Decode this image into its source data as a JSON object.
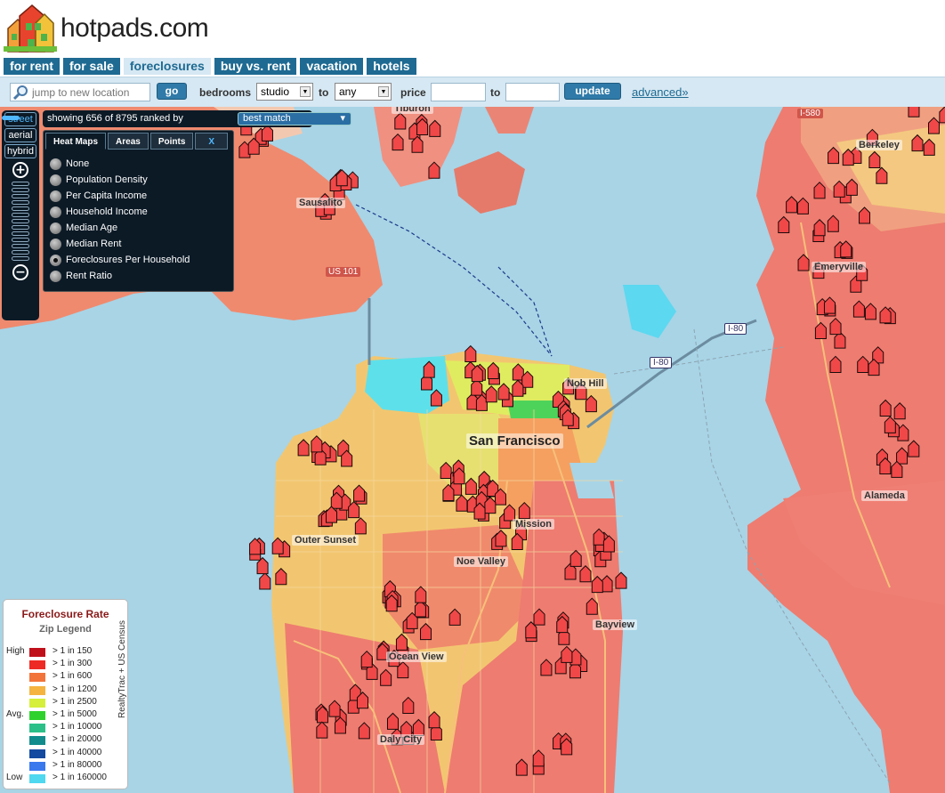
{
  "brand": {
    "name": "hotpads.com"
  },
  "tabs": [
    {
      "label": "for rent"
    },
    {
      "label": "for sale"
    },
    {
      "label": "foreclosures"
    },
    {
      "label": "buy vs. rent"
    },
    {
      "label": "vacation"
    },
    {
      "label": "hotels"
    }
  ],
  "search": {
    "placeholder": "jump to new location",
    "go_label": "go",
    "bedrooms_label": "bedrooms",
    "bedrooms_from": "studio",
    "to_label": "to",
    "bedrooms_to": "any",
    "price_label": "price",
    "price_to_label": "to",
    "update_label": "update",
    "advanced_label": "advanced»"
  },
  "view_controls": {
    "street": "street",
    "aerial": "aerial",
    "hybrid": "hybrid",
    "zoom_in": "+",
    "zoom_out": "−",
    "zoom_level": 7,
    "zoom_levels": 14
  },
  "results": {
    "showing_text": "showing 656 of 8795 ranked by",
    "rank_by": "best match"
  },
  "heat_panel": {
    "tabs": [
      "Heat Maps",
      "Areas",
      "Points",
      "X"
    ],
    "options": [
      "None",
      "Population Density",
      "Per Capita Income",
      "Household Income",
      "Median Age",
      "Median Rent",
      "Foreclosures Per Household",
      "Rent Ratio"
    ],
    "selected": "Foreclosures Per Household"
  },
  "map": {
    "place_labels": {
      "tiburon": "Tiburon",
      "berkeley": "Berkeley",
      "sausalito": "Sausalito",
      "emeryville": "Emeryville",
      "san_francisco": "San Francisco",
      "alameda": "Alameda",
      "outer_sunset": "Outer Sunset",
      "mission": "Mission",
      "noe_valley": "Noe Valley",
      "bayview": "Bayview",
      "ocean_view": "Ocean View",
      "daly_city": "Daly City",
      "nob_hill": "Nob Hill"
    },
    "shields": {
      "us101": "US 101",
      "i80": "I-80",
      "i80b": "I-80",
      "i580": "I-580"
    }
  },
  "legend": {
    "title": "Foreclosure Rate",
    "subtitle": "Zip Legend",
    "source": "RealtyTrac + US Census",
    "rows": [
      {
        "level": "High",
        "color": "#c0111b",
        "range": "> 1 in 150"
      },
      {
        "level": "",
        "color": "#ee2a24",
        "range": "> 1 in 300"
      },
      {
        "level": "",
        "color": "#f2743a",
        "range": "> 1 in 600"
      },
      {
        "level": "",
        "color": "#f5b340",
        "range": "> 1 in 1200"
      },
      {
        "level": "",
        "color": "#d6ef3a",
        "range": "> 1 in 2500"
      },
      {
        "level": "Avg.",
        "color": "#2fd12c",
        "range": "> 1 in 5000"
      },
      {
        "level": "",
        "color": "#2cc088",
        "range": "> 1 in 10000"
      },
      {
        "level": "",
        "color": "#128c8c",
        "range": "> 1 in 20000"
      },
      {
        "level": "",
        "color": "#144aa0",
        "range": "> 1 in 40000"
      },
      {
        "level": "",
        "color": "#3a78ee",
        "range": "> 1 in 80000"
      },
      {
        "level": "Low",
        "color": "#4fd8f0",
        "range": "> 1 in 160000"
      }
    ]
  },
  "colors": {
    "brand_blue": "#1e6a92",
    "water": "#a8d4e6",
    "high_rate": "#ee7c70"
  }
}
